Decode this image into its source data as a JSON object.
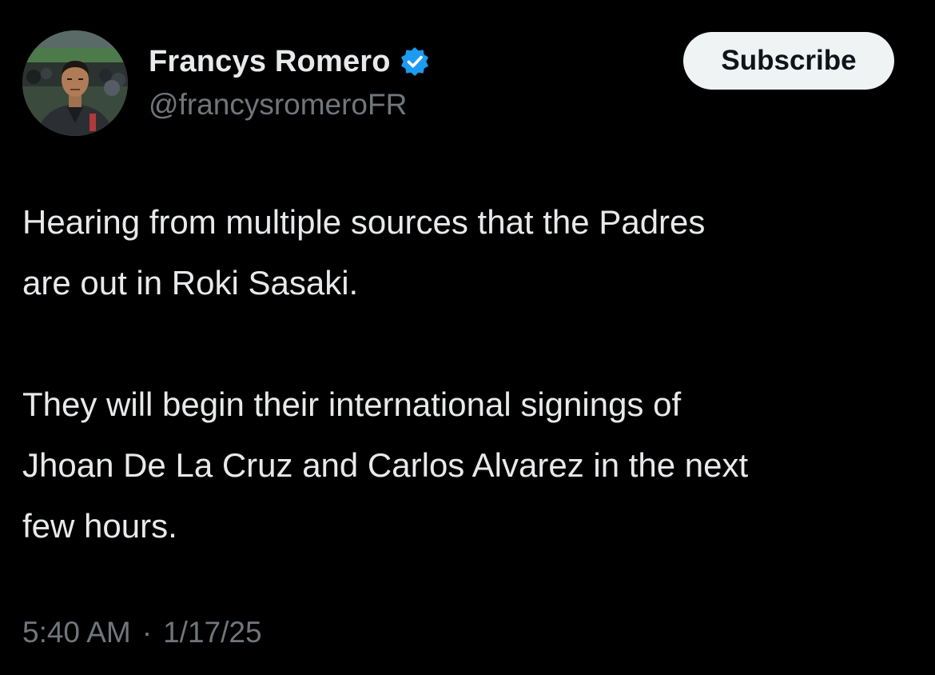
{
  "author": {
    "display_name": "Francys Romero",
    "handle": "@francysromeroFR",
    "verified": true,
    "verified_color": "#1d9bf0",
    "avatar_icon": "profile-photo"
  },
  "actions": {
    "subscribe_label": "Subscribe"
  },
  "tweet": {
    "paragraphs": [
      {
        "lines": [
          "Hearing from multiple sources that the Padres",
          "are out in Roki Sasaki."
        ]
      },
      {
        "lines": [
          "They will begin their international signings of",
          "Jhoan De La Cruz and Carlos Alvarez in the next",
          "few hours."
        ]
      }
    ]
  },
  "meta": {
    "time": "5:40 AM",
    "separator": "·",
    "date": "1/17/25"
  },
  "colors": {
    "background": "#000000",
    "text_primary": "#e7e9ea",
    "text_secondary": "#71767b",
    "button_bg": "#eff3f4",
    "button_text": "#0f1419"
  }
}
